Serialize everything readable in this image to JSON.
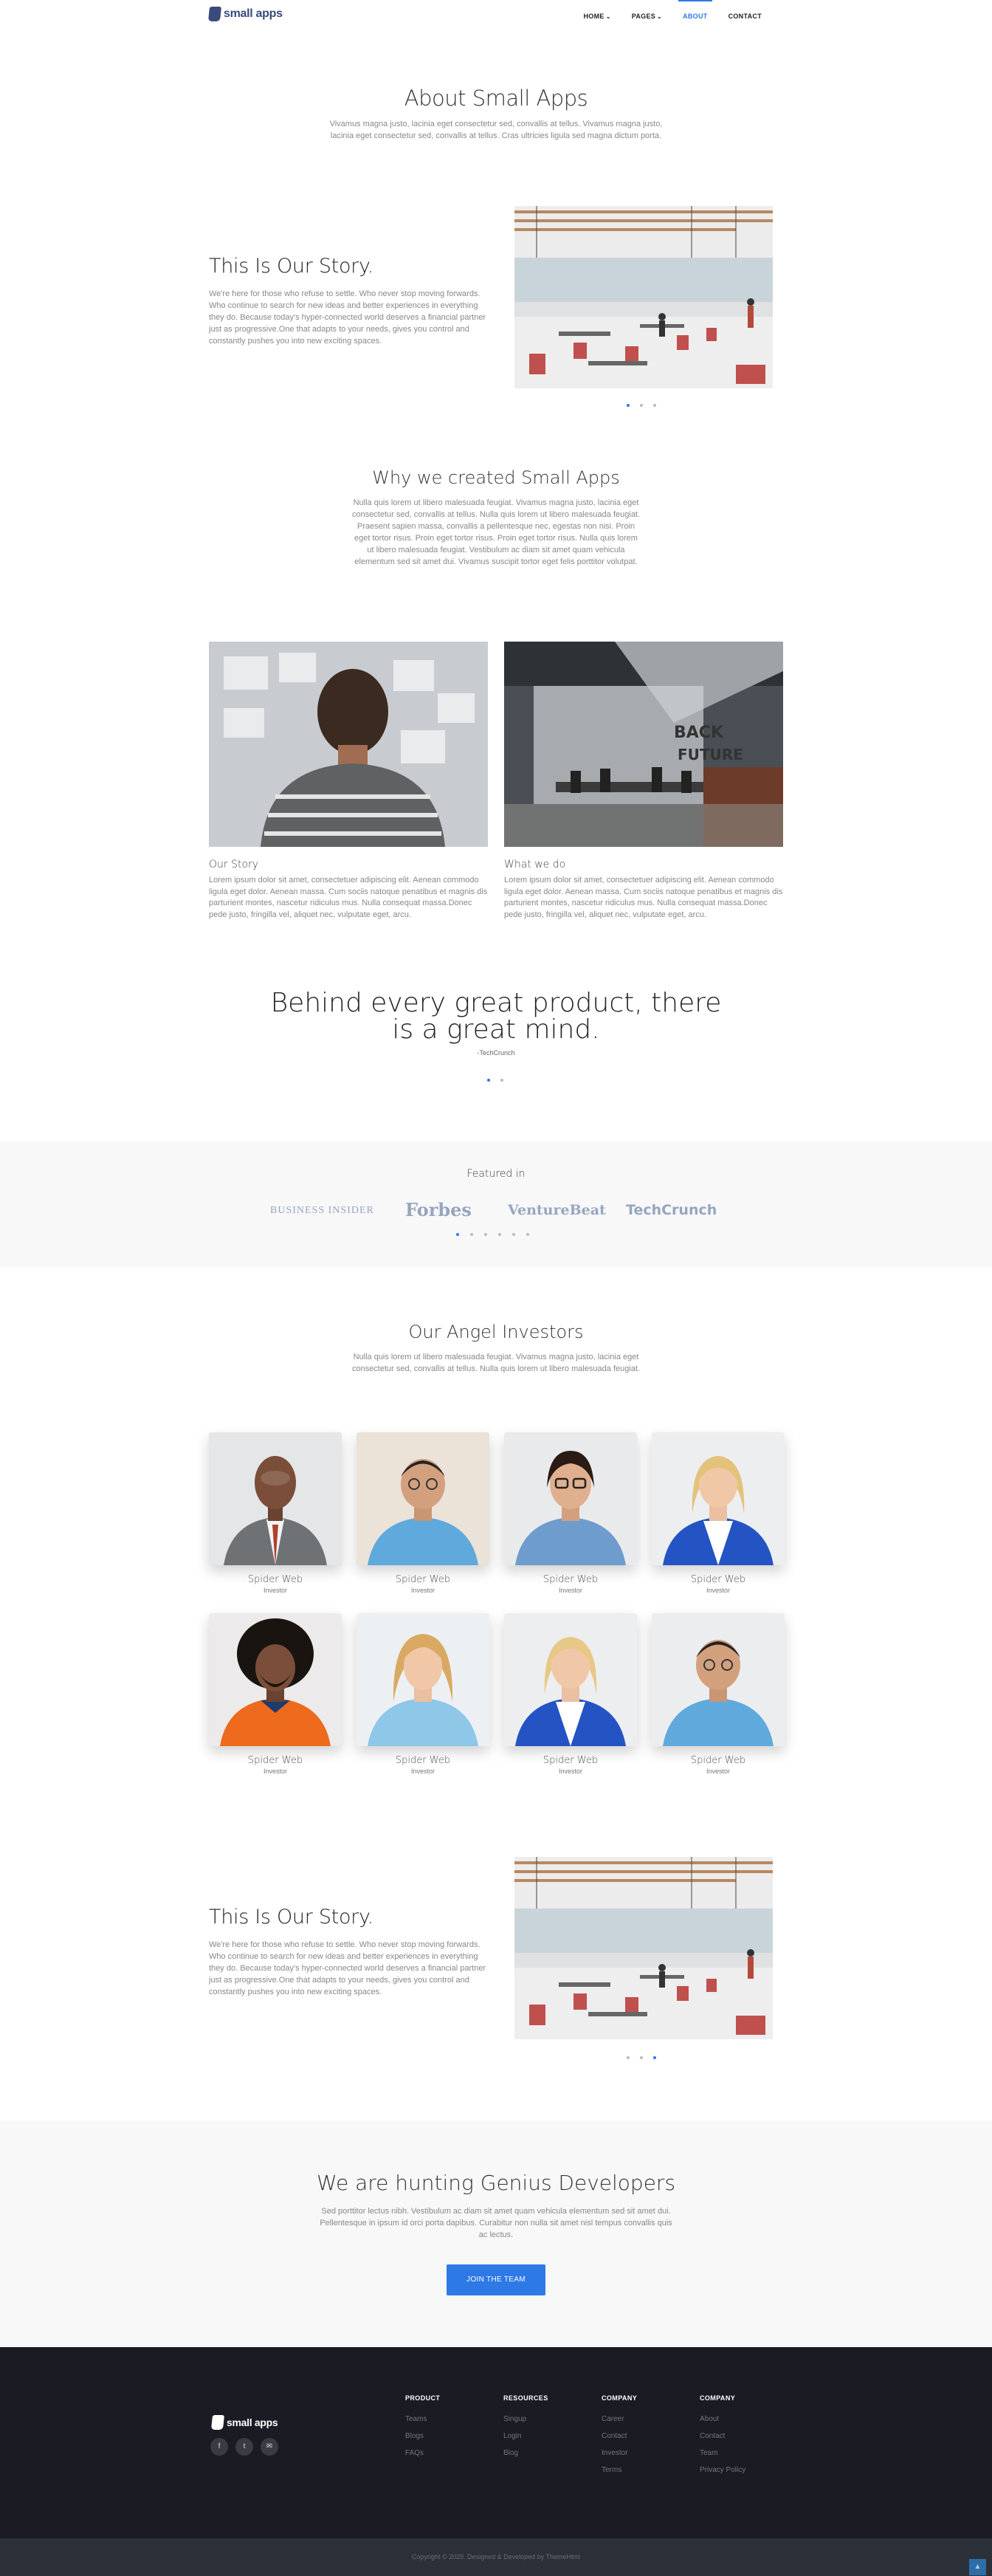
{
  "header": {
    "logo_text": "small apps",
    "nav": [
      {
        "label": "HOME",
        "has_dropdown": true
      },
      {
        "label": "PAGES",
        "has_dropdown": true
      },
      {
        "label": "ABOUT",
        "active": true
      },
      {
        "label": "CONTACT"
      }
    ]
  },
  "hero": {
    "title": "About Small Apps",
    "text": "Vivamus magna justo, lacinia eget consectetur sed, convallis at tellus. Vivamus magna justo, lacinia eget consectetur sed, convallis at tellus. Cras ultricies ligula sed magna dictum porta."
  },
  "story": {
    "title": "This Is Our Story.",
    "text": "We're here for those who refuse to settle. Who never stop moving forwards. Who continue to search for new ideas and better experiences in everything they do. Because today's hyper-connected world deserves a financial partner just as progressive.One that adapts to your needs, gives you control and constantly pushes you into new exciting spaces."
  },
  "why": {
    "title": "Why we created Small Apps",
    "text": "Nulla quis lorem ut libero malesuada feugiat. Vivamus magna justo, lacinia eget consectetur sed, convallis at tellus. Nulla quis lorem ut libero malesuada feugiat. Praesent sapien massa, convallis a pellentesque nec, egestas non nisi. Proin eget tortor risus. Proin eget tortor risus. Proin eget tortor risus. Nulla quis lorem ut libero malesuada feugiat. Vestibulum ac diam sit amet quam vehicula elementum sed sit amet dui. Vivamus suscipit tortor eget felis porttitor volutpat."
  },
  "cards": [
    {
      "title": "Our Story",
      "text": "Lorem ipsum dolor sit amet, consectetuer adipiscing elit. Aenean commodo ligula eget dolor. Aenean massa. Cum sociis natoque penatibus et magnis dis parturient montes, nascetur ridiculus mus. Nulla consequat massa.Donec pede justo, fringilla vel, aliquet nec, vulputate eget, arcu."
    },
    {
      "title": "What we do",
      "text": "Lorem ipsum dolor sit amet, consectetuer adipiscing elit. Aenean commodo ligula eget dolor. Aenean massa. Cum sociis natoque penatibus et magnis dis parturient montes, nascetur ridiculus mus. Nulla consequat massa.Donec pede justo, fringilla vel, aliquet nec, vulputate eget, arcu."
    }
  ],
  "quote": {
    "text": "Behind every great product, there is a great mind.",
    "author": "-TechCrunch"
  },
  "featured": {
    "label": "Featured in",
    "brands": [
      "BUSINESS INSIDER",
      "Forbes",
      "VentureBeat",
      "TechCrunch"
    ]
  },
  "investors": {
    "title": "Our Angel Investors",
    "text": "Nulla quis lorem ut libero malesuada feugiat. Vivamus magna justo, lacinia eget consectetur sed, convallis at tellus. Nulla quis lorem ut libero malesuada feugiat.",
    "people": [
      {
        "name": "Spider Web",
        "role": "Investor"
      },
      {
        "name": "Spider Web",
        "role": "Investor"
      },
      {
        "name": "Spider Web",
        "role": "Investor"
      },
      {
        "name": "Spider Web",
        "role": "Investor"
      },
      {
        "name": "Spider Web",
        "role": "Investor"
      },
      {
        "name": "Spider Web",
        "role": "Investor"
      },
      {
        "name": "Spider Web",
        "role": "Investor"
      },
      {
        "name": "Spider Web",
        "role": "Investor"
      }
    ]
  },
  "hunt": {
    "title": "We are hunting Genius Developers",
    "text": "Sed porttitor lectus nibh. Vestibulum ac diam sit amet quam vehicula elementum sed sit amet dui. Pellentesque in ipsum id orci porta dapibus. Curabitur non nulla sit amet nisl tempus convallis quis ac lectus.",
    "button": "JOIN THE TEAM"
  },
  "footer": {
    "logo_text": "small apps",
    "columns": [
      {
        "title": "PRODUCT",
        "links": [
          "Teams",
          "Blogs",
          "FAQs"
        ]
      },
      {
        "title": "RESOURCES",
        "links": [
          "Singup",
          "Login",
          "Blog"
        ]
      },
      {
        "title": "COMPANY",
        "links": [
          "Career",
          "Contact",
          "Investor",
          "Terms"
        ]
      },
      {
        "title": "COMPANY",
        "links": [
          "About",
          "Contact",
          "Team",
          "Privacy Policy"
        ]
      }
    ],
    "copyright": "Copyright © 2020. Designed & Developed by ThemeHtml"
  },
  "colors": {
    "accent": "#2d7ae6",
    "footer_bg": "#1a1b23",
    "section_bg": "#f8f8f9"
  }
}
